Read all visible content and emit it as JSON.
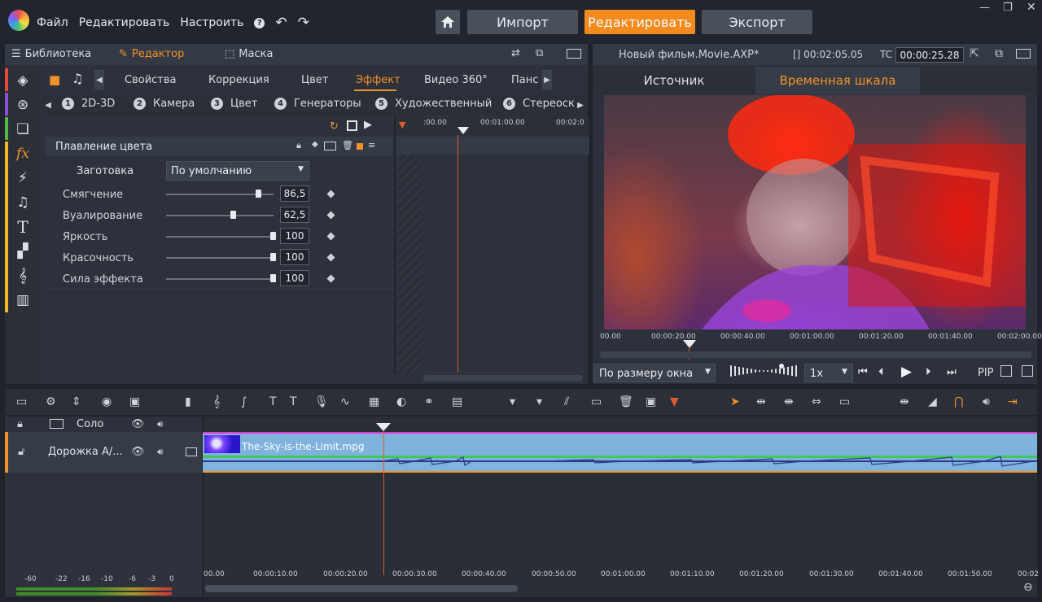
{
  "menu": {
    "file": "Файл",
    "edit": "Редактировать",
    "settings": "Настроить",
    "help": "?"
  },
  "modes": {
    "import": "Импорт",
    "edit": "Редактировать",
    "export": "Экспорт"
  },
  "left_tabs": {
    "library": "Библиотека",
    "editor": "Редактор",
    "mask": "Маска"
  },
  "prop_tabs": [
    "Свойства",
    "Коррекция",
    "Цвет",
    "Эффект",
    "Видео 360°",
    "Панс"
  ],
  "effect_categories": [
    {
      "num": "1",
      "label": "2D-3D"
    },
    {
      "num": "2",
      "label": "Камера"
    },
    {
      "num": "3",
      "label": "Цвет"
    },
    {
      "num": "4",
      "label": "Генераторы"
    },
    {
      "num": "5",
      "label": "Художественный"
    },
    {
      "num": "6",
      "label": "Стереоск"
    }
  ],
  "effect": {
    "name": "Плавление цвета",
    "preset_label": "Заготовка",
    "preset_value": "По умолчанию",
    "params": [
      {
        "label": "Смягчение",
        "value": "86,5",
        "level": 0.865
      },
      {
        "label": "Вуалирование",
        "value": "62,5",
        "level": 0.625
      },
      {
        "label": "Яркость",
        "value": "100",
        "level": 1
      },
      {
        "label": "Красочность",
        "value": "100",
        "level": 1
      },
      {
        "label": "Сила эффекта",
        "value": "100",
        "level": 1
      }
    ]
  },
  "kf_ruler": {
    "t0": ":00.00",
    "t1": "00:01:00.00",
    "t2": "00:02:0"
  },
  "preview": {
    "title": "Новый фильм.Movie.AXP*",
    "duration": "[] 00:02:05.05",
    "tc_label": "TC",
    "timecode": "00:00:25.28",
    "tab_source": "Источник",
    "tab_timeline": "Временная шкала",
    "fit": "По размеру окна",
    "speed": "1x",
    "pip": "PIP",
    "ruler": [
      "00.00",
      "00:00:20.00",
      "00:00:40.00",
      "00:01:00.00",
      "00:01:20.00",
      "00:01:40.00",
      "00:02:00.00"
    ]
  },
  "timeline": {
    "solo": "Соло",
    "track_name": "Дорожка A/...",
    "clip_name": "The-Sky-is-the-Limit.mpg",
    "ruler": [
      "00.00",
      "00:00:10.00",
      "00:00:20.00",
      "00:00:30.00",
      "00:00:40.00",
      "00:00:50.00",
      "00:01:00.00",
      "00:01:10.00",
      "00:01:20.00",
      "00:01:30.00",
      "00:01:40.00",
      "00:01:50.00",
      "00:02"
    ]
  },
  "meter": [
    "-60",
    "-22",
    "-16",
    "-10",
    "-6",
    "-3",
    "0"
  ],
  "colors": {
    "accent": "#f28a1e",
    "panel": "#2c313b",
    "clip": "#7fb2dc",
    "playhead": "#e05a2a"
  }
}
